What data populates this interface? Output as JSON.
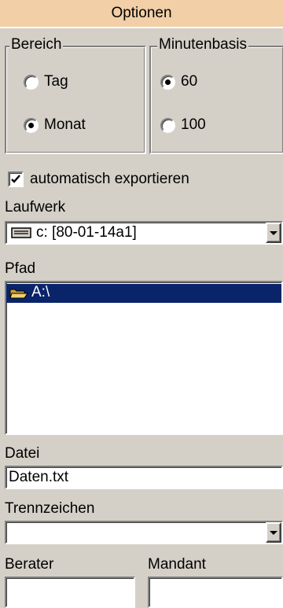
{
  "title": "Optionen",
  "bereich": {
    "legend": "Bereich",
    "options": [
      "Tag",
      "Monat"
    ],
    "selected": "Monat"
  },
  "minutenbasis": {
    "legend": "Minutenbasis",
    "options": [
      "60",
      "100"
    ],
    "selected": "60"
  },
  "auto_export": {
    "label": "automatisch exportieren",
    "checked": true
  },
  "laufwerk": {
    "label": "Laufwerk",
    "value": "c: [80-01-14a1]",
    "icon": "drive-icon"
  },
  "pfad": {
    "label": "Pfad",
    "items": [
      {
        "name": "A:\\",
        "icon": "open-folder-icon",
        "selected": true
      }
    ]
  },
  "datei": {
    "label": "Datei",
    "value": "Daten.txt"
  },
  "trennzeichen": {
    "label": "Trennzeichen",
    "value": ""
  },
  "berater": {
    "label": "Berater",
    "value": ""
  },
  "mandant": {
    "label": "Mandant",
    "value": ""
  }
}
